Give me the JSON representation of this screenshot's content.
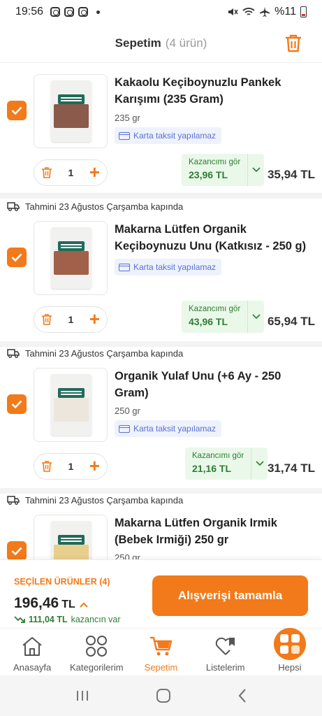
{
  "status_bar": {
    "time": "19:56",
    "battery": "%11"
  },
  "header": {
    "title": "Sepetim",
    "count": "(4 ürün)"
  },
  "items": [
    {
      "name": "Kakaolu Keçiboynuzlu Pankek Karışımı (235 Gram)",
      "weight": "235 gr",
      "taksit": "Karta taksit yapılamaz",
      "qty": "1",
      "kazanc_label": "Kazancımı gör",
      "kazanc_value": "23,96 TL",
      "price": "35,94 TL",
      "fill_color": "#8a5a4a"
    },
    {
      "delivery": "Tahmini 23 Ağustos Çarşamba kapında",
      "name": "Makarna Lütfen Organik Keçiboynuzu Unu (Katkısız - 250 g)",
      "taksit": "Karta taksit yapılamaz",
      "qty": "1",
      "kazanc_label": "Kazancımı gör",
      "kazanc_value": "43,96 TL",
      "price": "65,94 TL",
      "fill_color": "#a0604a"
    },
    {
      "delivery": "Tahmini 23 Ağustos Çarşamba kapında",
      "name": "Organik Yulaf Unu (+6 Ay - 250 Gram)",
      "weight": "250 gr",
      "taksit": "Karta taksit yapılamaz",
      "qty": "1",
      "kazanc_label": "Kazancımı gör",
      "kazanc_value": "21,16 TL",
      "price": "31,74 TL",
      "fill_color": "#ece6dc"
    },
    {
      "delivery": "Tahmini 23 Ağustos Çarşamba kapında",
      "name": "Makarna Lütfen Organik Irmik (Bebek Irmiği) 250 gr",
      "weight": "250 gr",
      "fill_color": "#e9cf8e"
    }
  ],
  "summary": {
    "selected_label": "SEÇİLEN ÜRÜNLER (4)",
    "total": "196,46",
    "currency": "TL",
    "earn_value": "111,04 TL",
    "earn_text": "kazancın var",
    "cta": "Alışverişi tamamla"
  },
  "nav": {
    "home": "Anasayfa",
    "categories": "Kategorilerim",
    "cart": "Sepetim",
    "lists": "Listelerim",
    "all": "Hepsi"
  },
  "colors": {
    "accent": "#f27a1a",
    "green": "#2e7d32",
    "taksit_blue": "#5a6fd6"
  }
}
